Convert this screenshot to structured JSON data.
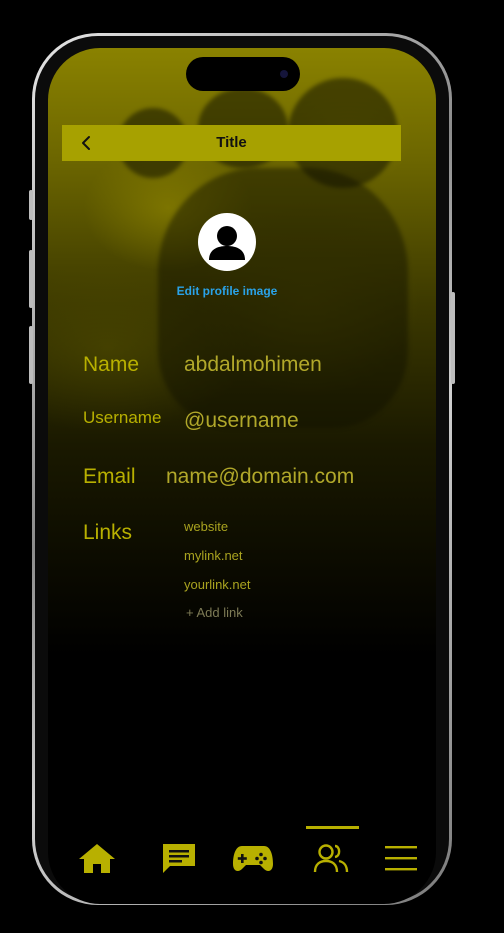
{
  "header": {
    "title": "Title"
  },
  "profile": {
    "edit_image_label": "Edit profile image"
  },
  "fields": {
    "name_label": "Name",
    "name_value": "abdalmohimen",
    "username_label": "Username",
    "username_value": "@username",
    "email_label": "Email",
    "email_value": "name@domain.com",
    "links_label": "Links"
  },
  "links": [
    "website",
    "mylink.net",
    "yourlink.net"
  ],
  "add_link_label": "+ Add link",
  "tabbar": {
    "items": [
      "home-icon",
      "chat-icon",
      "gamepad-icon",
      "friends-icon",
      "menu-icon"
    ],
    "active": "friends-icon"
  },
  "colors": {
    "accent": "#b8b000",
    "link": "#2aa3e8",
    "background": "#000000"
  }
}
